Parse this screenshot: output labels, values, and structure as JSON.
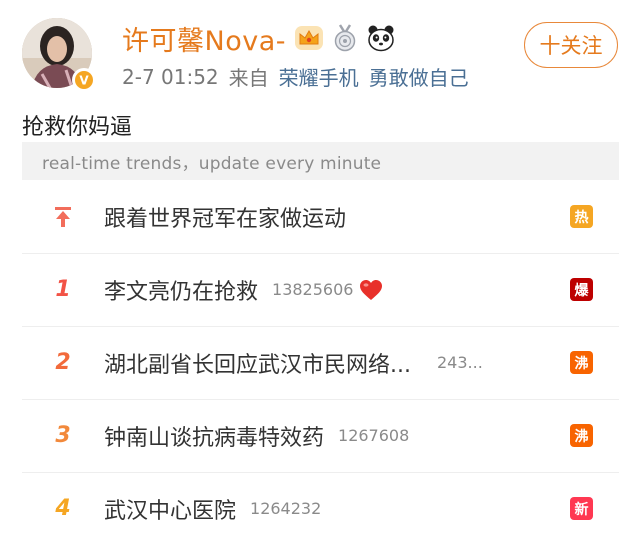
{
  "post": {
    "username": "许可馨Nova-",
    "timestamp": "2-7 01:52",
    "source_prefix": "来自",
    "device": "荣耀手机",
    "slogan": "勇敢做自己",
    "follow_label": "十关注",
    "text": "抢救你妈逼"
  },
  "trends": {
    "header": "real-time trends，update every minute",
    "items": [
      {
        "rank": "",
        "rank_icon": "pin-icon",
        "title": "跟着世界冠军在家做运动",
        "count": "",
        "tag": "热",
        "tag_color": "#f5a623",
        "rank_color": "#f26d5b"
      },
      {
        "rank": "1",
        "title": "李文亮仍在抢救",
        "count": "13825606",
        "tag": "爆",
        "tag_color": "#bd0000",
        "rank_color": "#f25346",
        "has_heart": true
      },
      {
        "rank": "2",
        "title": "湖北副省长回应武汉市民网络...",
        "count": "243...",
        "tag": "沸",
        "tag_color": "#f86400",
        "rank_color": "#f26a3b"
      },
      {
        "rank": "3",
        "title": "钟南山谈抗病毒特效药",
        "count": "1267608",
        "tag": "沸",
        "tag_color": "#f86400",
        "rank_color": "#f2893b"
      },
      {
        "rank": "4",
        "title": "武汉中心医院",
        "count": "1264232",
        "tag": "新",
        "tag_color": "#ff3852",
        "rank_color": "#f5a623"
      }
    ]
  },
  "colors": {
    "brand_orange": "#e57a1d",
    "link_blue": "#4a6f94",
    "heart_red": "#e8302a"
  }
}
